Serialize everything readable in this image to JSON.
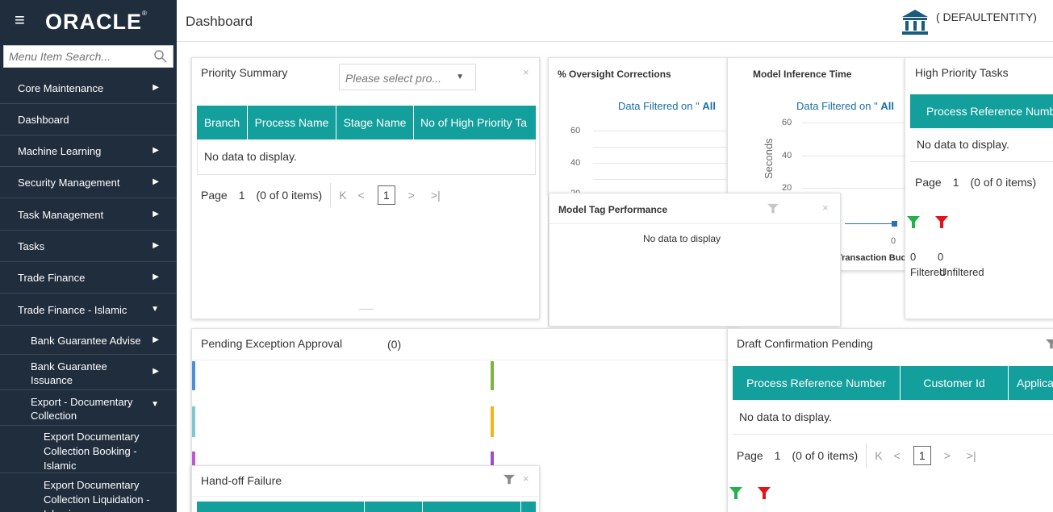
{
  "header": {
    "logo": "ORACLE",
    "page_title": "Dashboard",
    "entity": "( DEFAULTENTITY)"
  },
  "sidebar": {
    "search_placeholder": "Menu Item Search...",
    "items": [
      {
        "label": "Core Maintenance"
      },
      {
        "label": "Dashboard"
      },
      {
        "label": "Machine Learning"
      },
      {
        "label": "Security Management"
      },
      {
        "label": "Task Management"
      },
      {
        "label": "Tasks"
      },
      {
        "label": "Trade Finance"
      },
      {
        "label": "Trade Finance - Islamic"
      },
      {
        "label": "Bank Guarantee Advise"
      },
      {
        "label": "Bank Guarantee Issuance"
      },
      {
        "label": "Export - Documentary Collection"
      },
      {
        "label": "Export Documentary Collection Booking - Islamic"
      },
      {
        "label": "Export Documentary Collection Liquidation - Islamic"
      }
    ]
  },
  "priority_summary": {
    "title": "Priority Summary",
    "select_placeholder": "Please select pro...",
    "columns": [
      "Branch",
      "Process Name",
      "Stage Name",
      "No of High Priority Ta"
    ],
    "no_data": "No data to display.",
    "page_label": "Page",
    "page_num": "1",
    "items": "(0 of 0 items)",
    "current_page": "1"
  },
  "oversight": {
    "title": "% Oversight Corrections",
    "filter_prefix": "Data Filtered on \" ",
    "filter_value": "All",
    "ticks": [
      "60",
      "40",
      "20"
    ]
  },
  "inference": {
    "title": "Model Inference Time",
    "filter_prefix": "Data Filtered on \" ",
    "filter_value": "All",
    "ticks": [
      "60",
      "40",
      "20"
    ],
    "ylabel": "Seconds",
    "xlabel": "Transaction Bucket",
    "xtick": "0"
  },
  "high_priority": {
    "title": "High Priority Tasks",
    "column": "Process Reference Number",
    "no_data": "No data to display.",
    "page_label": "Page",
    "page_num": "1",
    "items": "(0 of 0 items)",
    "filtered_count": "0",
    "unfiltered_count": "0",
    "filtered_label": "Filtered",
    "unfiltered_label": "Unfiltered"
  },
  "tag_performance": {
    "title": "Model Tag Performance",
    "no_data": "No data to display"
  },
  "pending_exception": {
    "title": "Pending Exception Approval",
    "count": "(0)"
  },
  "draft_confirmation": {
    "title": "Draft Confirmation Pending",
    "columns": [
      "Process Reference Number",
      "Customer Id",
      "Application"
    ],
    "no_data": "No data to display.",
    "page_label": "Page",
    "page_num": "1",
    "items": "(0 of 0 items)",
    "current_page": "1"
  },
  "handoff": {
    "title": "Hand-off Failure"
  },
  "colors": {
    "sidebar_bg": "#1f2d3d",
    "grid_header": "#139f9c",
    "link_blue": "#1a6fa3",
    "filter_green": "#22b14c",
    "filter_red": "#e3131b"
  },
  "icons": [
    "hamburger-icon",
    "bank-icon",
    "search-icon",
    "chevron-right-icon",
    "chevron-down-icon",
    "close-icon",
    "filter-icon"
  ]
}
